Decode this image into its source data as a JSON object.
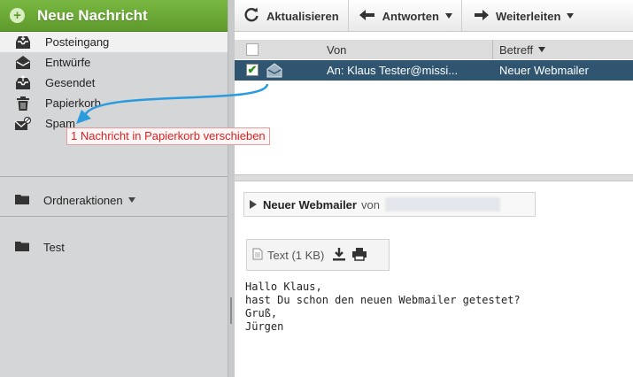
{
  "sidebar": {
    "new_message": "Neue Nachricht",
    "folders": [
      {
        "label": "Posteingang",
        "icon": "inbox-icon"
      },
      {
        "label": "Entwürfe",
        "icon": "drafts-icon"
      },
      {
        "label": "Gesendet",
        "icon": "sent-icon"
      },
      {
        "label": "Papierkorb",
        "icon": "trash-icon"
      },
      {
        "label": "Spam",
        "icon": "spam-icon"
      }
    ],
    "folder_actions": "Ordneraktionen",
    "custom_folder": "Test"
  },
  "toolbar": {
    "refresh": "Aktualisieren",
    "reply": "Antworten",
    "forward": "Weiterleiten"
  },
  "message_list": {
    "col_from": "Von",
    "col_subject": "Betreff",
    "rows": [
      {
        "from": "An: Klaus Tester@missi...",
        "subject": "Neuer Webmailer",
        "checked": true
      }
    ]
  },
  "drag_tooltip": "1 Nachricht in Papierkorb verschieben",
  "preview": {
    "subject": "Neuer Webmailer",
    "from_prefix": "von",
    "attachment": "Text (1 KB)",
    "body": [
      "Hallo Klaus,",
      "",
      "hast Du schon den neuen Webmailer getestet?",
      "",
      "Gruß,",
      "Jürgen"
    ]
  },
  "colors": {
    "accent_green": "#5e9a2c",
    "selected_row": "#2f5570",
    "sidebar_bg": "#d4d6d7",
    "tooltip_text": "#e02020",
    "drag_arrow": "#2a9bdc"
  }
}
